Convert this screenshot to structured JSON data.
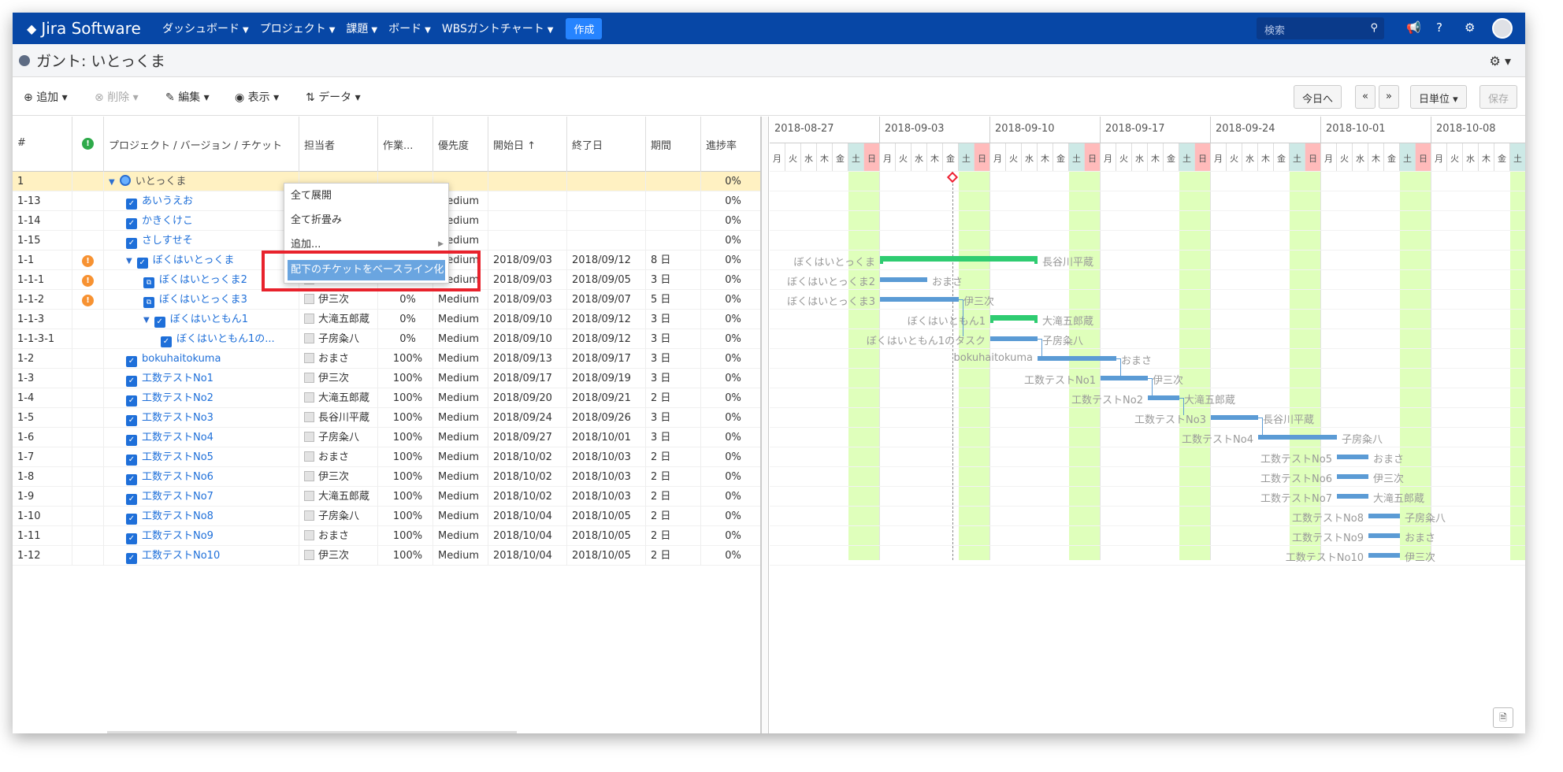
{
  "app": {
    "name": "Jira Software"
  },
  "nav": {
    "items": [
      "ダッシュボード",
      "プロジェクト",
      "課題",
      "ボード",
      "WBSガントチャート"
    ],
    "create": "作成",
    "search_placeholder": "検索"
  },
  "page": {
    "title": "ガント: いとっくま"
  },
  "toolbar": {
    "add": "追加",
    "delete": "削除",
    "edit": "編集",
    "view": "表示",
    "data": "データ",
    "today": "今日へ",
    "prev": "«",
    "next": "»",
    "unit": "日単位",
    "save": "保存"
  },
  "columns": {
    "num": "#",
    "title": "プロジェクト / バージョン / チケット",
    "assignee": "担当者",
    "work": "作業...",
    "priority": "優先度",
    "start": "開始日 ↑",
    "end": "終了日",
    "period": "期間",
    "progress": "進捗率"
  },
  "context_menu": {
    "items": [
      "全て展開",
      "全て折畳み",
      "追加...",
      "配下のチケットをベースライン化"
    ]
  },
  "rows": [
    {
      "num": "1",
      "title": "いとっくま",
      "assignee": "",
      "work": "",
      "priority": "",
      "start": "",
      "end": "",
      "period": "",
      "progress": "0%"
    },
    {
      "num": "1-13",
      "title": "あいうえお",
      "assignee": "",
      "work": "",
      "priority": "Medium",
      "start": "",
      "end": "",
      "period": "",
      "progress": "0%"
    },
    {
      "num": "1-14",
      "title": "かきくけこ",
      "assignee": "",
      "work": "",
      "priority": "Medium",
      "start": "",
      "end": "",
      "period": "",
      "progress": "0%"
    },
    {
      "num": "1-15",
      "title": "さしすせそ",
      "assignee": "",
      "work": "",
      "priority": "Medium",
      "start": "",
      "end": "",
      "period": "",
      "progress": "0%"
    },
    {
      "num": "1-1",
      "title": "ぼくはいとっくま",
      "assignee": "",
      "work": "",
      "priority": "Medium",
      "start": "2018/09/03",
      "end": "2018/09/12",
      "period": "8 日",
      "progress": "0%"
    },
    {
      "num": "1-1-1",
      "title": "ぼくはいとっくま2",
      "assignee": "おまさ",
      "work": "",
      "priority": "Medium",
      "start": "2018/09/03",
      "end": "2018/09/05",
      "period": "3 日",
      "progress": "0%"
    },
    {
      "num": "1-1-2",
      "title": "ぼくはいとっくま3",
      "assignee": "伊三次",
      "work": "0%",
      "priority": "Medium",
      "start": "2018/09/03",
      "end": "2018/09/07",
      "period": "5 日",
      "progress": "0%"
    },
    {
      "num": "1-1-3",
      "title": "ぼくはいともん1",
      "assignee": "大滝五郎蔵",
      "work": "0%",
      "priority": "Medium",
      "start": "2018/09/10",
      "end": "2018/09/12",
      "period": "3 日",
      "progress": "0%"
    },
    {
      "num": "1-1-3-1",
      "title": "ぼくはいともん1の...",
      "assignee": "子房粂八",
      "work": "0%",
      "priority": "Medium",
      "start": "2018/09/10",
      "end": "2018/09/12",
      "period": "3 日",
      "progress": "0%"
    },
    {
      "num": "1-2",
      "title": "bokuhaitokuma",
      "assignee": "おまさ",
      "work": "100%",
      "priority": "Medium",
      "start": "2018/09/13",
      "end": "2018/09/17",
      "period": "3 日",
      "progress": "0%"
    },
    {
      "num": "1-3",
      "title": "工数テストNo1",
      "assignee": "伊三次",
      "work": "100%",
      "priority": "Medium",
      "start": "2018/09/17",
      "end": "2018/09/19",
      "period": "3 日",
      "progress": "0%"
    },
    {
      "num": "1-4",
      "title": "工数テストNo2",
      "assignee": "大滝五郎蔵",
      "work": "100%",
      "priority": "Medium",
      "start": "2018/09/20",
      "end": "2018/09/21",
      "period": "2 日",
      "progress": "0%"
    },
    {
      "num": "1-5",
      "title": "工数テストNo3",
      "assignee": "長谷川平蔵",
      "work": "100%",
      "priority": "Medium",
      "start": "2018/09/24",
      "end": "2018/09/26",
      "period": "3 日",
      "progress": "0%"
    },
    {
      "num": "1-6",
      "title": "工数テストNo4",
      "assignee": "子房粂八",
      "work": "100%",
      "priority": "Medium",
      "start": "2018/09/27",
      "end": "2018/10/01",
      "period": "3 日",
      "progress": "0%"
    },
    {
      "num": "1-7",
      "title": "工数テストNo5",
      "assignee": "おまさ",
      "work": "100%",
      "priority": "Medium",
      "start": "2018/10/02",
      "end": "2018/10/03",
      "period": "2 日",
      "progress": "0%"
    },
    {
      "num": "1-8",
      "title": "工数テストNo6",
      "assignee": "伊三次",
      "work": "100%",
      "priority": "Medium",
      "start": "2018/10/02",
      "end": "2018/10/03",
      "period": "2 日",
      "progress": "0%"
    },
    {
      "num": "1-9",
      "title": "工数テストNo7",
      "assignee": "大滝五郎蔵",
      "work": "100%",
      "priority": "Medium",
      "start": "2018/10/02",
      "end": "2018/10/03",
      "period": "2 日",
      "progress": "0%"
    },
    {
      "num": "1-10",
      "title": "工数テストNo8",
      "assignee": "子房粂八",
      "work": "100%",
      "priority": "Medium",
      "start": "2018/10/04",
      "end": "2018/10/05",
      "period": "2 日",
      "progress": "0%"
    },
    {
      "num": "1-11",
      "title": "工数テストNo9",
      "assignee": "おまさ",
      "work": "100%",
      "priority": "Medium",
      "start": "2018/10/04",
      "end": "2018/10/05",
      "period": "2 日",
      "progress": "0%"
    },
    {
      "num": "1-12",
      "title": "工数テストNo10",
      "assignee": "伊三次",
      "work": "100%",
      "priority": "Medium",
      "start": "2018/10/04",
      "end": "2018/10/05",
      "period": "2 日",
      "progress": "0%"
    }
  ],
  "gantt": {
    "weeks": [
      "2018-08-27",
      "2018-09-03",
      "2018-09-10",
      "2018-09-17",
      "2018-09-24",
      "2018-10-01",
      "2018-10-08"
    ],
    "weekdays": [
      "月",
      "火",
      "水",
      "木",
      "金",
      "土",
      "日"
    ],
    "bars": [
      {
        "row": 4,
        "start": "2018/09/03",
        "end": "2018/09/12",
        "type": "group",
        "left_label": "ぼくはいとっくま",
        "right_label": "長谷川平蔵"
      },
      {
        "row": 5,
        "start": "2018/09/03",
        "end": "2018/09/05",
        "type": "task",
        "left_label": "ぼくはいとっくま2",
        "right_label": "おまさ"
      },
      {
        "row": 6,
        "start": "2018/09/03",
        "end": "2018/09/07",
        "type": "task",
        "left_label": "ぼくはいとっくま3",
        "right_label": "伊三次"
      },
      {
        "row": 7,
        "start": "2018/09/10",
        "end": "2018/09/12",
        "type": "group",
        "left_label": "ぼくはいともん1",
        "right_label": "大滝五郎蔵"
      },
      {
        "row": 8,
        "start": "2018/09/10",
        "end": "2018/09/12",
        "type": "task",
        "left_label": "ぼくはいともん1のタスク",
        "right_label": "子房粂八"
      },
      {
        "row": 9,
        "start": "2018/09/13",
        "end": "2018/09/17",
        "type": "task",
        "left_label": "bokuhaitokuma",
        "right_label": "おまさ"
      },
      {
        "row": 10,
        "start": "2018/09/17",
        "end": "2018/09/19",
        "type": "task",
        "left_label": "工数テストNo1",
        "right_label": "伊三次"
      },
      {
        "row": 11,
        "start": "2018/09/20",
        "end": "2018/09/21",
        "type": "task",
        "left_label": "工数テストNo2",
        "right_label": "大滝五郎蔵"
      },
      {
        "row": 12,
        "start": "2018/09/24",
        "end": "2018/09/26",
        "type": "task",
        "left_label": "工数テストNo3",
        "right_label": "長谷川平蔵"
      },
      {
        "row": 13,
        "start": "2018/09/27",
        "end": "2018/10/01",
        "type": "task",
        "left_label": "工数テストNo4",
        "right_label": "子房粂八"
      },
      {
        "row": 14,
        "start": "2018/10/02",
        "end": "2018/10/03",
        "type": "task",
        "left_label": "工数テストNo5",
        "right_label": "おまさ"
      },
      {
        "row": 15,
        "start": "2018/10/02",
        "end": "2018/10/03",
        "type": "task",
        "left_label": "工数テストNo6",
        "right_label": "伊三次"
      },
      {
        "row": 16,
        "start": "2018/10/02",
        "end": "2018/10/03",
        "type": "task",
        "left_label": "工数テストNo7",
        "right_label": "大滝五郎蔵"
      },
      {
        "row": 17,
        "start": "2018/10/04",
        "end": "2018/10/05",
        "type": "task",
        "left_label": "工数テストNo8",
        "right_label": "子房粂八"
      },
      {
        "row": 18,
        "start": "2018/10/04",
        "end": "2018/10/05",
        "type": "task",
        "left_label": "工数テストNo9",
        "right_label": "おまさ"
      },
      {
        "row": 19,
        "start": "2018/10/04",
        "end": "2018/10/05",
        "type": "task",
        "left_label": "工数テストNo10",
        "right_label": "伊三次"
      }
    ]
  }
}
